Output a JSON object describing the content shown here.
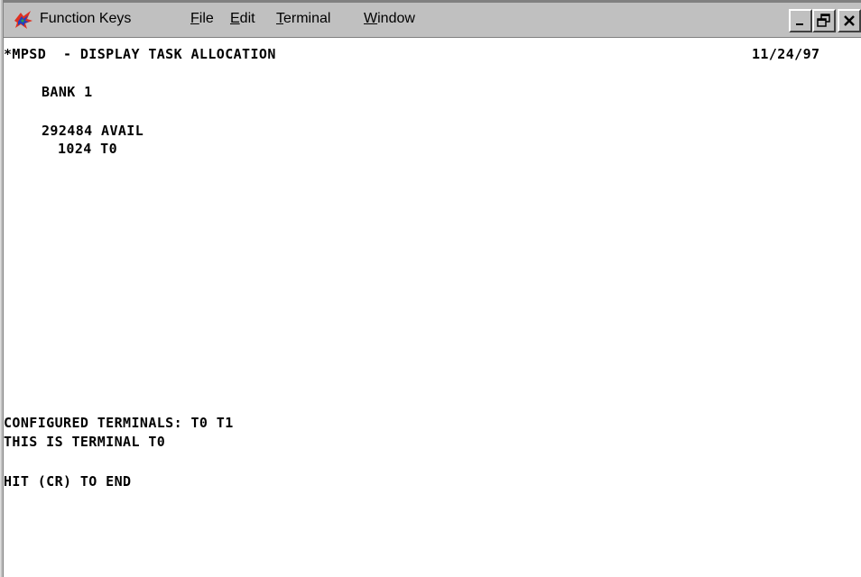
{
  "menubar": {
    "function_keys": "Function Keys",
    "file_first": "F",
    "file_rest": "ile",
    "edit_first": "E",
    "edit_rest": "dit",
    "terminal_first": "T",
    "terminal_rest": "erminal",
    "window_first": "W",
    "window_rest": "indow"
  },
  "screen": {
    "header_title": "*MPSD  - DISPLAY TASK ALLOCATION",
    "header_date": "11/24/97",
    "bank": "BANK 1",
    "avail": "292484 AVAIL",
    "task_line": "1024 T0",
    "configured_terminals": "CONFIGURED TERMINALS: T0 T1",
    "this_terminal": "THIS IS TERMINAL T0",
    "prompt": "HIT (CR) TO END"
  },
  "colors": {
    "chrome": "#c0c0c0",
    "screen_background": "#ffffff",
    "text": "#000000"
  }
}
